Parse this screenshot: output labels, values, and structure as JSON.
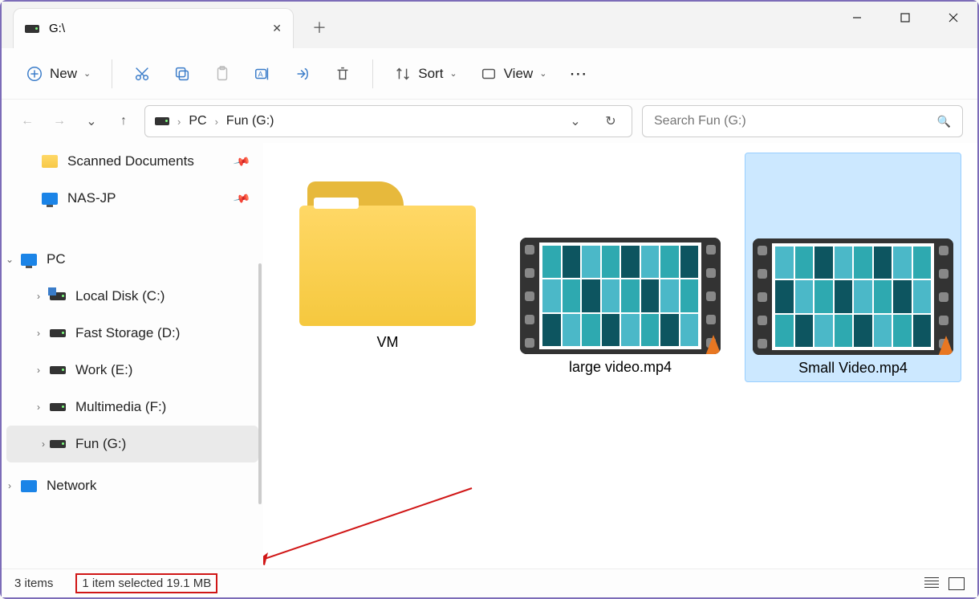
{
  "tab": {
    "title": "G:\\"
  },
  "toolbar": {
    "new_label": "New",
    "sort_label": "Sort",
    "view_label": "View"
  },
  "breadcrumb": {
    "items": [
      "PC",
      "Fun (G:)"
    ]
  },
  "search": {
    "placeholder": "Search Fun (G:)"
  },
  "sidebar": {
    "pinned": [
      {
        "label": "Scanned Documents",
        "icon": "folder"
      },
      {
        "label": "NAS-JP",
        "icon": "monitor"
      }
    ],
    "pc_label": "PC",
    "drives": [
      {
        "label": "Local Disk (C:)",
        "icon": "windisk"
      },
      {
        "label": "Fast Storage (D:)",
        "icon": "disk"
      },
      {
        "label": "Work (E:)",
        "icon": "disk"
      },
      {
        "label": "Multimedia (F:)",
        "icon": "disk"
      },
      {
        "label": "Fun (G:)",
        "icon": "disk",
        "active": true
      }
    ],
    "network_label": "Network"
  },
  "files": [
    {
      "name": "VM",
      "type": "folder",
      "selected": false
    },
    {
      "name": "large video.mp4",
      "type": "video",
      "selected": false
    },
    {
      "name": "Small Video.mp4",
      "type": "video",
      "selected": true
    }
  ],
  "status": {
    "count": "3 items",
    "selection": "1 item selected  19.1 MB"
  }
}
